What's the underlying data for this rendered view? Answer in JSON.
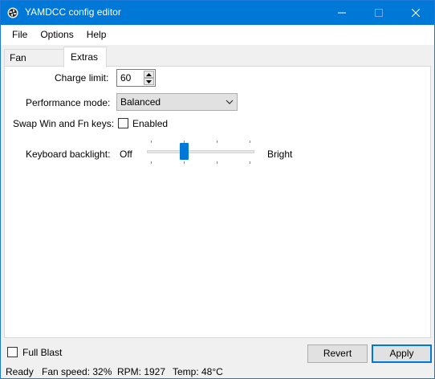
{
  "window": {
    "title": "YAMDCC config editor",
    "accent_color": "#0078d7",
    "controls": [
      "minimize-icon",
      "maximize-icon",
      "close-icon"
    ]
  },
  "menu": {
    "items": [
      {
        "label": "File"
      },
      {
        "label": "Options"
      },
      {
        "label": "Help"
      }
    ]
  },
  "tabs": [
    {
      "label": "Fan Control",
      "selected": false
    },
    {
      "label": "Extras",
      "selected": true
    }
  ],
  "extras": {
    "charge_limit": {
      "label": "Charge limit:",
      "value": "60"
    },
    "performance_mode": {
      "label": "Performance mode:",
      "value": "Balanced"
    },
    "swap_keys": {
      "label": "Swap Win and Fn keys:",
      "checkbox_label": "Enabled",
      "checked": false
    },
    "backlight": {
      "label": "Keyboard backlight:",
      "min_label": "Off",
      "max_label": "Bright",
      "level": 0.33
    }
  },
  "footer": {
    "full_blast": {
      "label": "Full Blast",
      "checked": false
    },
    "revert_label": "Revert",
    "apply_label": "Apply"
  },
  "status": {
    "state": "Ready",
    "fan_speed": "Fan speed: 32%",
    "rpm": "RPM: 1927",
    "temp": "Temp: 48°C"
  }
}
